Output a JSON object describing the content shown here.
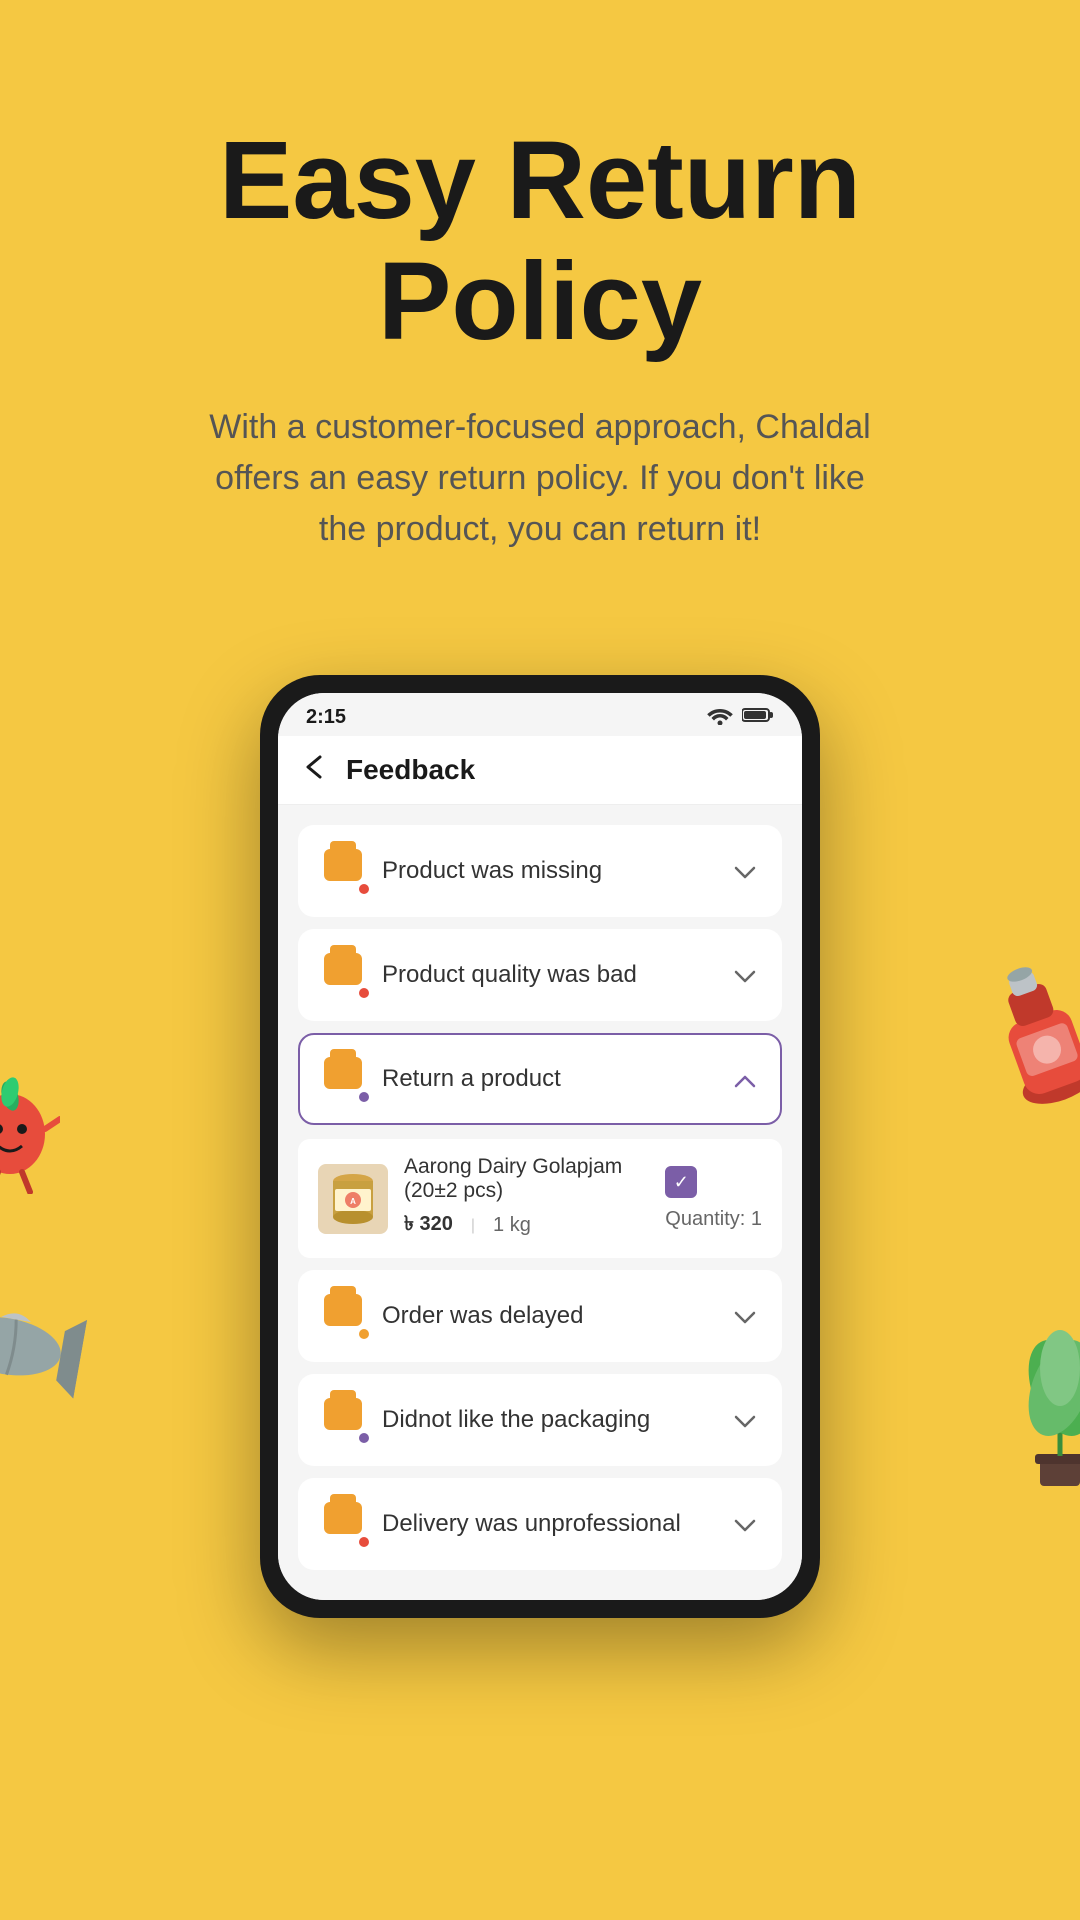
{
  "hero": {
    "title": "Easy Return\nPolicy",
    "subtitle": "With a customer-focused approach, Chaldal offers an easy return policy. If you don't like the product, you can return it!"
  },
  "phone": {
    "status_bar": {
      "time": "2:15",
      "wifi": "📶",
      "battery": "🔋"
    },
    "header": {
      "back_label": "←",
      "title": "Feedback"
    },
    "feedback_items": [
      {
        "id": "missing",
        "label": "Product was missing",
        "icon_dot_color": "red",
        "expanded": false,
        "chevron": "chevron-down"
      },
      {
        "id": "quality",
        "label": "Product quality was bad",
        "icon_dot_color": "red",
        "expanded": false,
        "chevron": "chevron-down"
      },
      {
        "id": "return",
        "label": "Return a product",
        "icon_dot_color": "purple",
        "expanded": true,
        "chevron": "chevron-up"
      },
      {
        "id": "delayed",
        "label": "Order was delayed",
        "icon_dot_color": "orange",
        "expanded": false,
        "chevron": "chevron-down"
      },
      {
        "id": "packaging",
        "label": "Didnot like the packaging",
        "icon_dot_color": "purple",
        "expanded": false,
        "chevron": "chevron-down"
      },
      {
        "id": "delivery",
        "label": "Delivery was unprofessional",
        "icon_dot_color": "red",
        "expanded": false,
        "chevron": "chevron-down"
      }
    ],
    "product": {
      "name": "Aarong Dairy Golapjam (20±2 pcs)",
      "price": "৳ 320",
      "weight": "1 kg",
      "quantity_label": "Quantity: 1",
      "checked": true
    }
  }
}
